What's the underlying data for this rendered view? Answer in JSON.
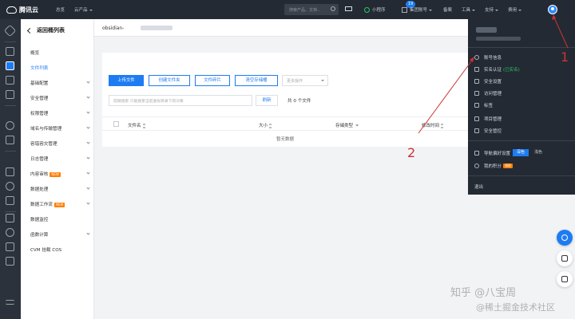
{
  "topbar": {
    "brand": "腾讯云",
    "home": "总览",
    "products": "云产品",
    "search_placeholder": "搜索产品、文档...",
    "mail_badge": "19",
    "mini_program": "小程序",
    "group_account": "集团账号",
    "filing": "备案",
    "tools": "工具",
    "support": "支持",
    "billing": "费用"
  },
  "nav": {
    "back": "返回桶列表",
    "items": [
      "概览",
      "文件列表",
      "基础配置",
      "安全管理",
      "权限管理",
      "域名与传输管理",
      "容错容灾管理",
      "日志管理",
      "内容审核",
      "数据处理",
      "数据工作流",
      "数据监控",
      "函数计算",
      "CVM 挂载 COS"
    ],
    "new_tag": "NEW"
  },
  "bucket": {
    "name": "obsidian-"
  },
  "toolbar": {
    "upload": "上传文件",
    "create_folder": "创建文件夹",
    "fragments": "文件碎片",
    "clear_bucket": "清空存储桶",
    "more_actions": "更多操作",
    "search_placeholder": "前缀搜索 只能搜索当前虚拟目录下的对象",
    "refresh": "刷新",
    "count": "共 0 个文件"
  },
  "table": {
    "headers": [
      "文件名",
      "大小",
      "存储类型",
      "修改时间"
    ],
    "empty": "暂无数据"
  },
  "dropdown": {
    "items": [
      {
        "icon": "user-icon",
        "label": "账号信息"
      },
      {
        "icon": "id-card-icon",
        "label": "实名认证",
        "extra": "(已实名)"
      },
      {
        "icon": "shield-icon",
        "label": "安全设置"
      },
      {
        "icon": "key-icon",
        "label": "访问管理"
      },
      {
        "icon": "tag-icon",
        "label": "标签"
      },
      {
        "icon": "project-icon",
        "label": "项目管理"
      },
      {
        "icon": "lock-icon",
        "label": "安全管控"
      }
    ],
    "nav_pref": "导航偏好设置",
    "dark": "深色",
    "light": "浅色",
    "points": "我的积分",
    "points_tag": "领取",
    "logout": "退出"
  },
  "annotations": {
    "one": "1",
    "two": "2"
  },
  "watermark": {
    "line1": "知乎 @八宝周",
    "line2": "@稀土掘金技术社区"
  },
  "colors": {
    "accent": "#1e7cf2",
    "topbar": "#232a33",
    "annotation": "#cc3333"
  }
}
